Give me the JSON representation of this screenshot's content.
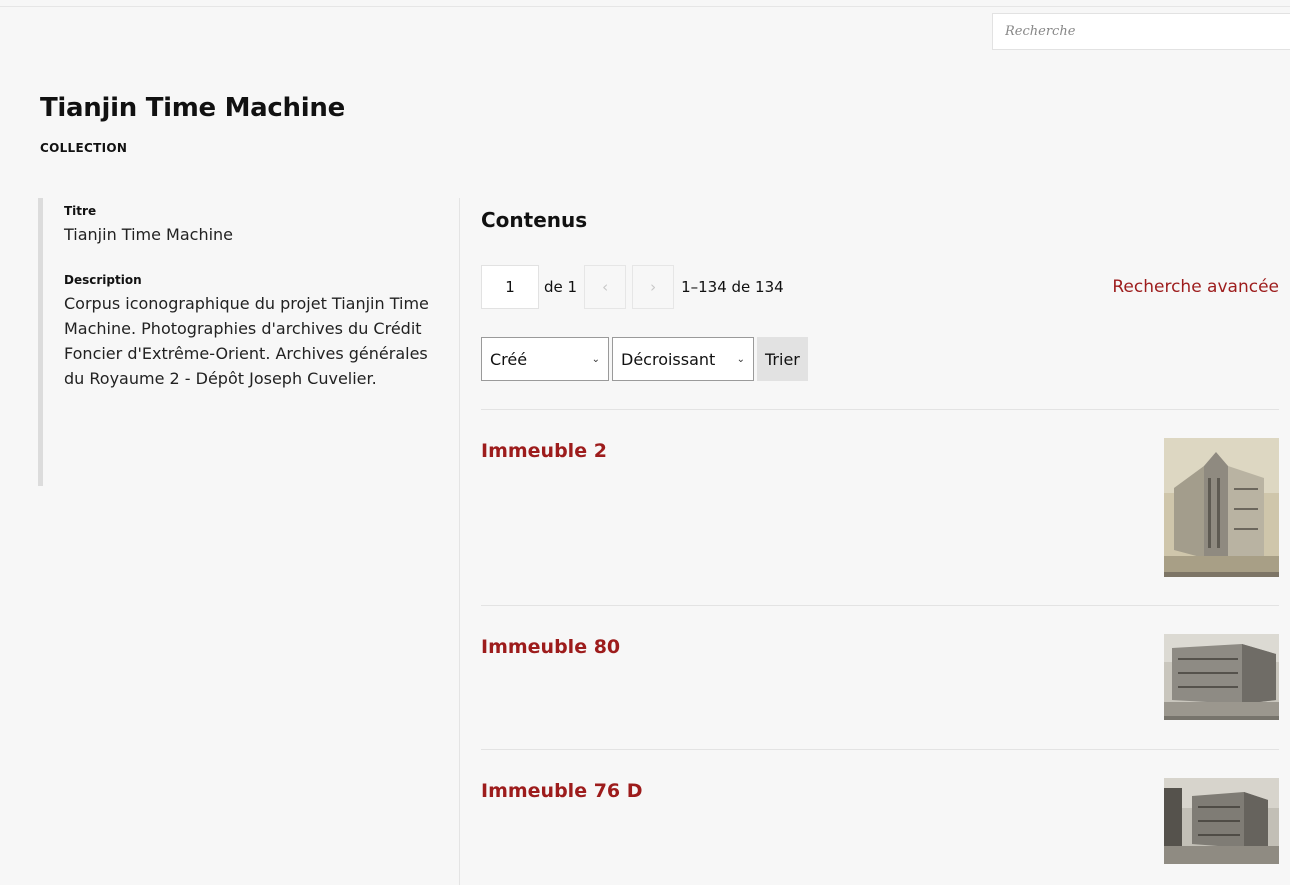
{
  "search": {
    "placeholder": "Recherche"
  },
  "header": {
    "title": "Tianjin Time Machine",
    "type": "Collection"
  },
  "metadata": [
    {
      "label": "Titre",
      "value": "Tianjin Time Machine"
    },
    {
      "label": "Description",
      "value": "Corpus iconographique du projet Tianjin Time Machine. Photographies d'archives du Crédit Foncier d'Extrême-Orient. Archives générales du Royaume 2 - Dépôt Joseph Cuvelier."
    }
  ],
  "contents": {
    "heading": "Contenus",
    "pagination": {
      "current_page": "1",
      "of_label": "de 1",
      "prev_icon": "‹",
      "next_icon": "›",
      "range": "1–134 de 134"
    },
    "advanced_search": "Recherche avancée",
    "sort": {
      "field": "Créé",
      "order": "Décroissant",
      "button": "Trier"
    },
    "items": [
      {
        "title": "Immeuble 2",
        "thumb": "sepia-corner-building-photo"
      },
      {
        "title": "Immeuble 80",
        "thumb": "grey-block-building-photo"
      },
      {
        "title": "Immeuble 76 D",
        "thumb": "grey-factory-building-photo"
      }
    ]
  }
}
